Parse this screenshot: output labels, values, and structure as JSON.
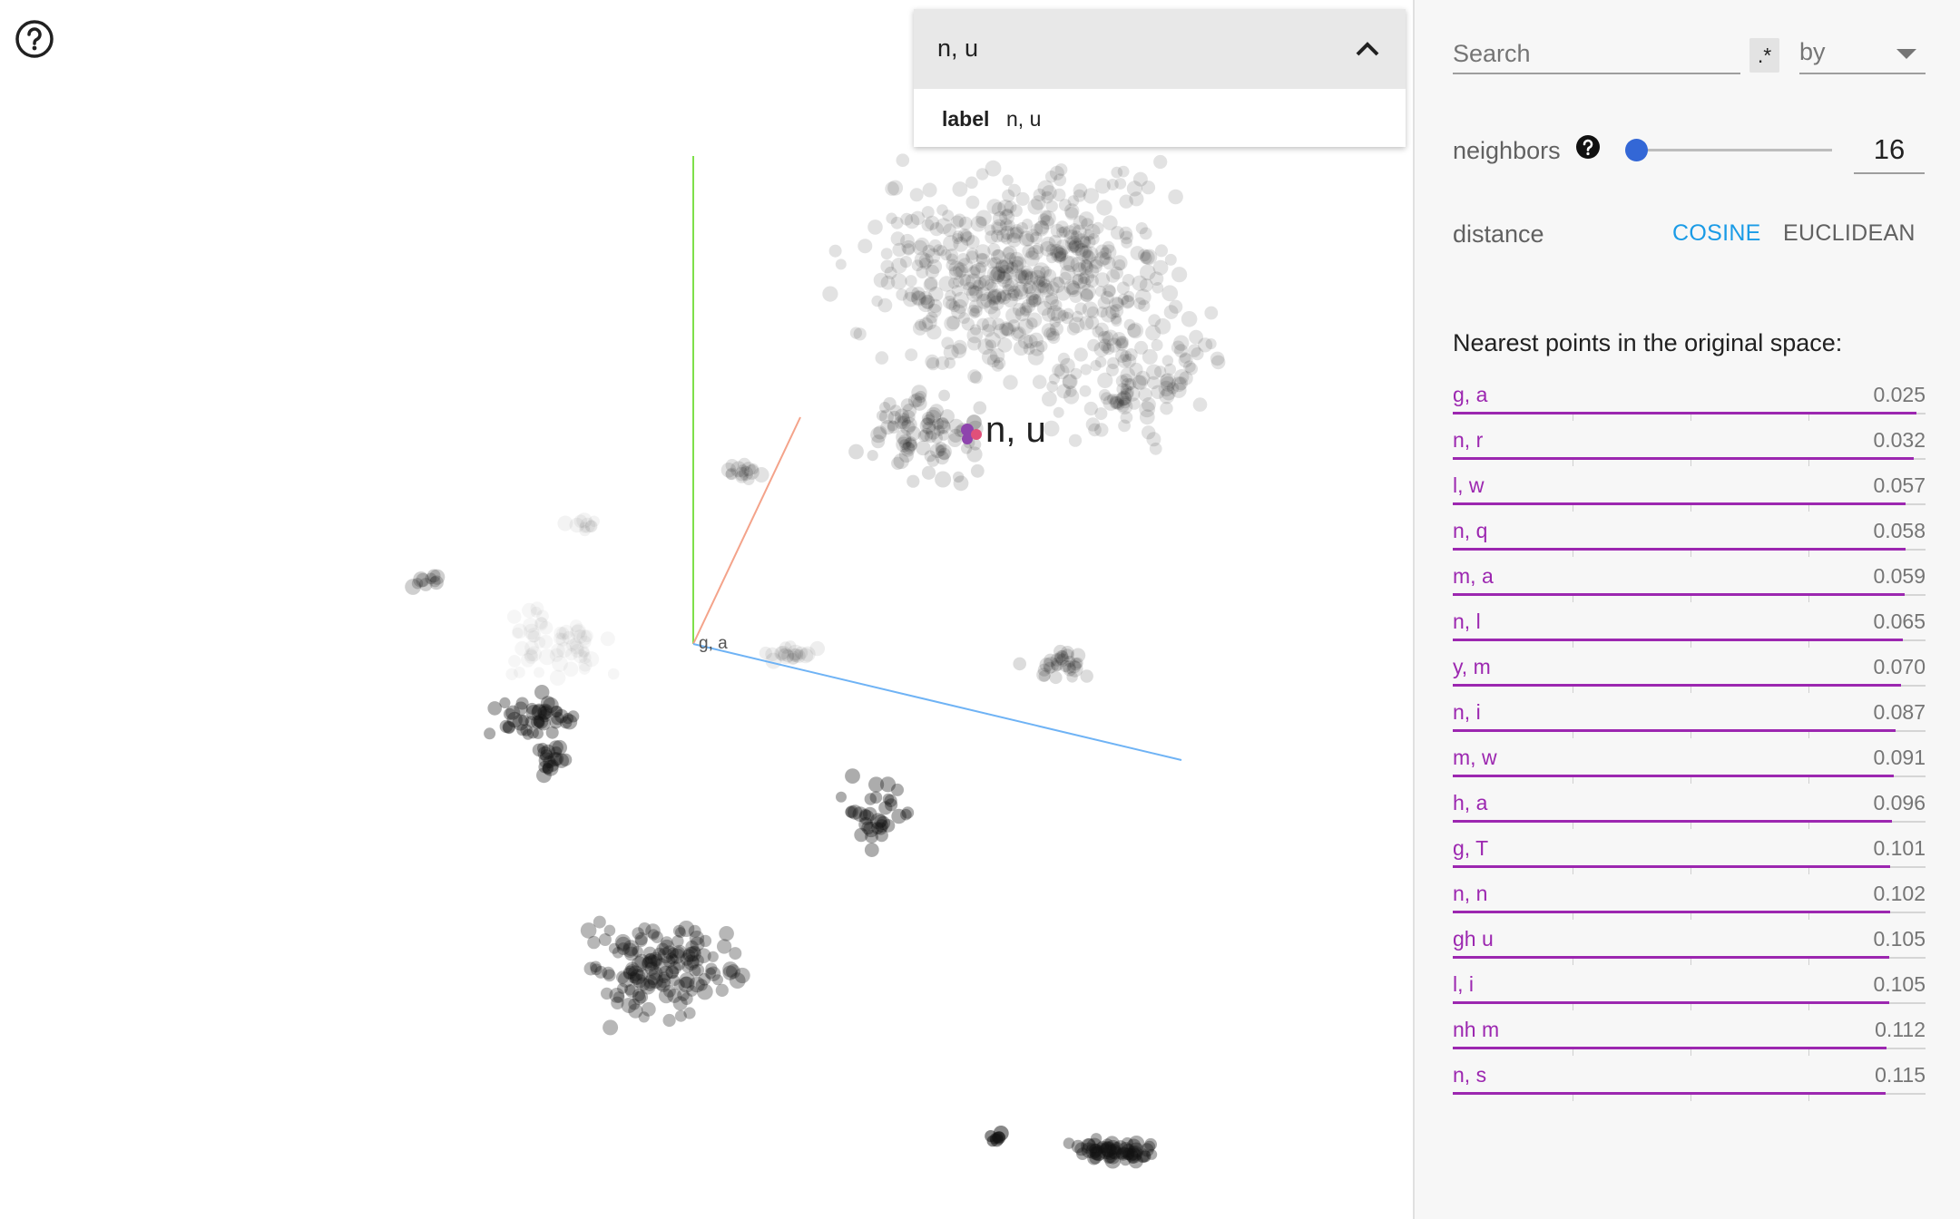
{
  "scatter": {
    "selected_label": "n, u",
    "origin_label": "g, a"
  },
  "help_button": {
    "icon": "help-circle-icon"
  },
  "point_card": {
    "title": "n, u",
    "collapse_icon": "chevron-up-icon",
    "metadata": [
      {
        "key": "label",
        "value": "n, u"
      }
    ]
  },
  "inspector": {
    "search": {
      "placeholder": "Search",
      "value": ""
    },
    "regex_toggle": ".*",
    "by_select": {
      "label": "by",
      "icon": "dropdown-arrow-icon"
    },
    "neighbors": {
      "label": "neighbors",
      "value": "16",
      "slider_fraction": 0.0,
      "help_icon": "help-icon"
    },
    "distance": {
      "label": "distance",
      "options": [
        "COSINE",
        "EUCLIDEAN"
      ],
      "selected": "COSINE"
    },
    "nearest_heading": "Nearest points in the original space:",
    "nearest_points": [
      {
        "label": "g, a",
        "value": "0.025"
      },
      {
        "label": "n, r",
        "value": "0.032"
      },
      {
        "label": "l, w",
        "value": "0.057"
      },
      {
        "label": "n, q",
        "value": "0.058"
      },
      {
        "label": "m, a",
        "value": "0.059"
      },
      {
        "label": "n, l",
        "value": "0.065"
      },
      {
        "label": "y, m",
        "value": "0.070"
      },
      {
        "label": "n, i",
        "value": "0.087"
      },
      {
        "label": "m, w",
        "value": "0.091"
      },
      {
        "label": "h, a",
        "value": "0.096"
      },
      {
        "label": "g, T",
        "value": "0.101"
      },
      {
        "label": "n, n",
        "value": "0.102"
      },
      {
        "label": "gh u",
        "value": "0.105"
      },
      {
        "label": "l, i",
        "value": "0.105"
      },
      {
        "label": "nh m",
        "value": "0.112"
      },
      {
        "label": "n, s",
        "value": "0.115"
      }
    ]
  },
  "colors": {
    "accent_blue": "#1a9be6",
    "neighbor_purple": "#9c27b0",
    "slider_blue": "#3367d6",
    "axis_green": "#7ee04a",
    "axis_red": "#f4a38a",
    "axis_blue": "#6fb3f5"
  }
}
